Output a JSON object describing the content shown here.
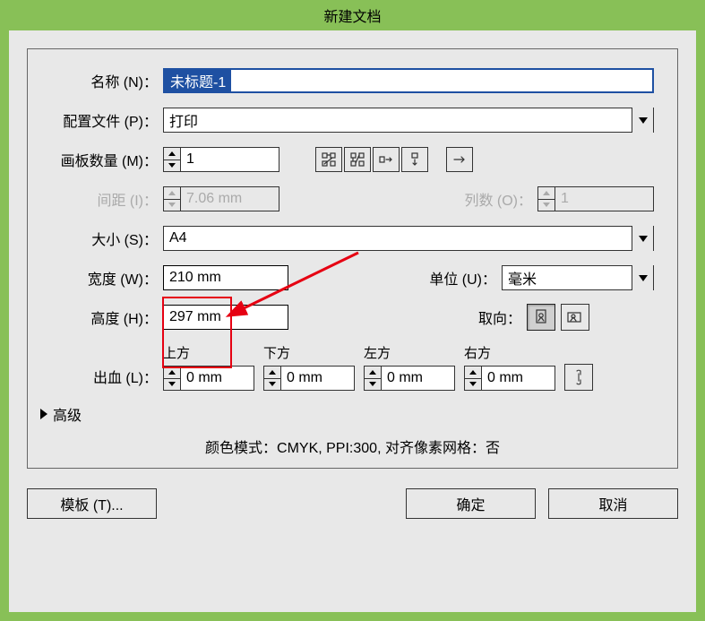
{
  "title": "新建文档",
  "labels": {
    "name": "名称 (N)：",
    "profile": "配置文件 (P)：",
    "artboards": "画板数量 (M)：",
    "spacing": "间距 (I)：",
    "cols": "列数 (O)：",
    "size": "大小 (S)：",
    "width": "宽度 (W)：",
    "height": "高度 (H)：",
    "units": "单位 (U)：",
    "orient": "取向：",
    "bleed": "出血 (L)：",
    "bleed_top": "上方",
    "bleed_bottom": "下方",
    "bleed_left": "左方",
    "bleed_right": "右方",
    "advanced": "高级"
  },
  "values": {
    "name": "未标题-1",
    "profile": "打印",
    "artboards": "1",
    "spacing": "7.06 mm",
    "cols": "1",
    "size": "A4",
    "width": "210 mm",
    "height": "297 mm",
    "units": "毫米",
    "bleed_top": "0 mm",
    "bleed_bottom": "0 mm",
    "bleed_left": "0 mm",
    "bleed_right": "0 mm"
  },
  "footer_info": "颜色模式：CMYK, PPI:300, 对齐像素网格：否",
  "buttons": {
    "templates": "模板 (T)...",
    "ok": "确定",
    "cancel": "取消"
  }
}
